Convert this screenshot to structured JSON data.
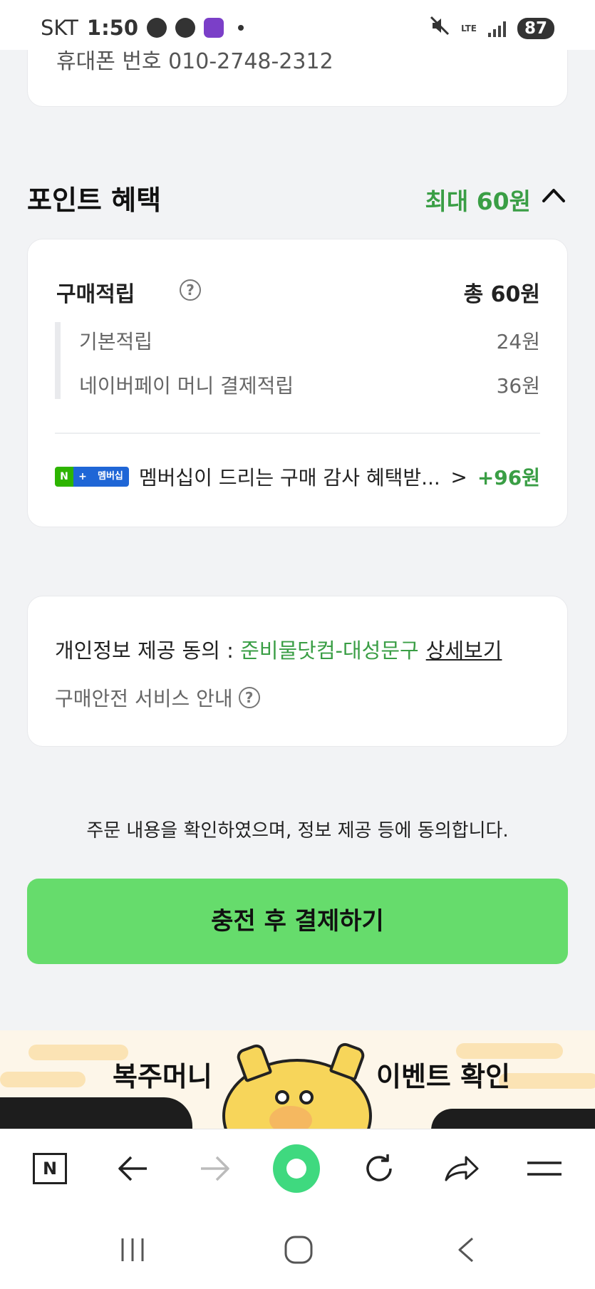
{
  "status_bar": {
    "carrier": "SKT",
    "time": "1:50",
    "network": "LTE",
    "battery": "87"
  },
  "order": {
    "phone_line": "휴대폰 번호 010-2748-2312"
  },
  "points": {
    "section_title": "포인트 혜택",
    "max_benefit": "최대 60원",
    "purchase_title": "구매적립",
    "purchase_total": "총 60원",
    "rows": [
      {
        "label": "기본적립",
        "value": "24원"
      },
      {
        "label": "네이버페이 머니 결제적립",
        "value": "36원"
      }
    ],
    "membership": {
      "badge_n": "N",
      "badge_plus": "+",
      "badge_label": "멤버십",
      "message": "멤버십이 드리는 구매 감사 혜택받...",
      "arrow": ">",
      "amount": "+96원"
    }
  },
  "consent": {
    "label": "개인정보 제공 동의 : ",
    "seller": "준비물닷컴-대성문구",
    "detail_link": "상세보기",
    "safe_service": "구매안전 서비스 안내"
  },
  "agree_text": "주문 내용을 확인하였으며, 정보 제공 등에 동의합니다.",
  "pay_button": "충전 후 결제하기",
  "banner": {
    "left_text": "복주머니",
    "right_text": "이벤트 확인"
  },
  "browser_bar": {
    "home_label": "N",
    "icons": [
      "n-home-icon",
      "back-arrow-icon",
      "forward-arrow-icon",
      "record-icon",
      "refresh-icon",
      "share-icon",
      "menu-icon"
    ]
  },
  "colors": {
    "accent_green": "#3a9e45",
    "button_green": "#66dc6c",
    "record_green": "#3fd97f",
    "background": "#f2f3f5"
  }
}
